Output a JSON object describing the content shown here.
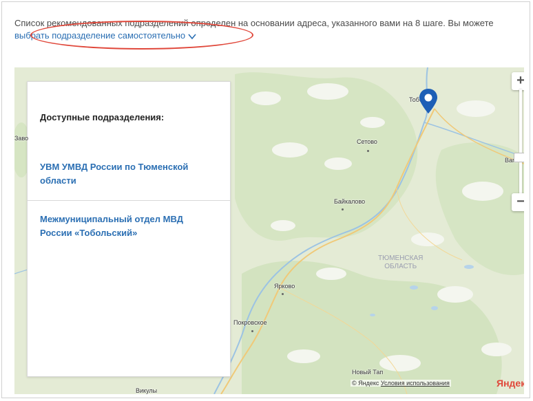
{
  "intro": {
    "text": "Список рекомендованных подразделений определен на основании адреса, указанного вами на 8 шаге. Вы можете ",
    "link": "выбрать подразделение самостоятельно"
  },
  "panel": {
    "title": "Доступные подразделения:",
    "units": [
      "УВМ УМВД России по Тюменской области",
      "Межмуниципальный отдел МВД России «Тобольский»"
    ]
  },
  "map": {
    "places": [
      "Тобольск",
      "Сетово",
      "Байкалово",
      "Ярково",
      "Покровское",
      "Новый Тап",
      "Вагай",
      "Викулы",
      "Заво"
    ],
    "region_line1": "ТЮМЕНСКАЯ",
    "region_line2": "ОБЛАСТЬ",
    "zoom_in": "+",
    "zoom_out": "−",
    "copyright": "© Яндекс",
    "terms": "Условия использования",
    "logo": "Яндекс",
    "marker_color": "#1d5fb6"
  },
  "colors": {
    "link": "#2b6fb3",
    "highlight": "#e0473a"
  }
}
